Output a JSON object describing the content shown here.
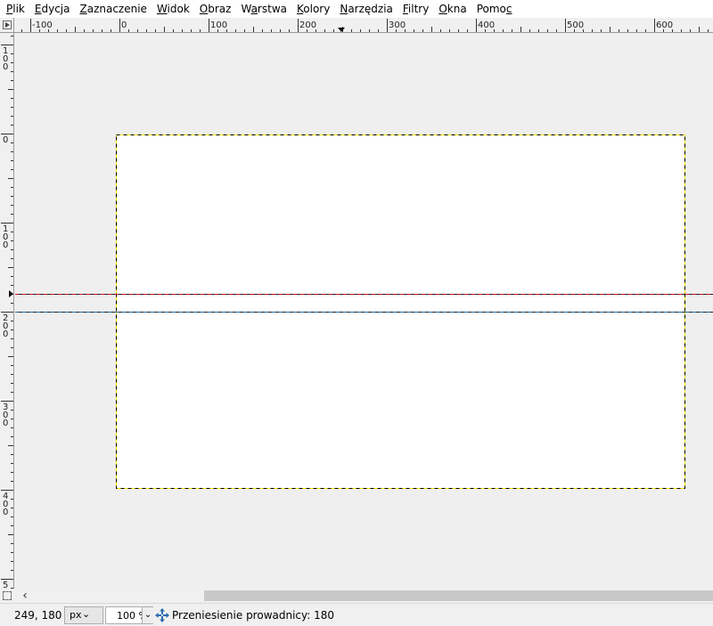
{
  "menubar": {
    "items": [
      {
        "before": "",
        "key": "P",
        "after": "lik"
      },
      {
        "before": "",
        "key": "E",
        "after": "dycja"
      },
      {
        "before": "",
        "key": "Z",
        "after": "aznaczenie"
      },
      {
        "before": "",
        "key": "W",
        "after": "idok"
      },
      {
        "before": "",
        "key": "O",
        "after": "braz"
      },
      {
        "before": "W",
        "key": "a",
        "after": "rstwa"
      },
      {
        "before": "",
        "key": "K",
        "after": "olory"
      },
      {
        "before": "",
        "key": "N",
        "after": "arzędzia"
      },
      {
        "before": "",
        "key": "F",
        "after": "iltry"
      },
      {
        "before": "",
        "key": "O",
        "after": "kna"
      },
      {
        "before": "Pomo",
        "key": "c",
        "after": ""
      }
    ]
  },
  "rulers": {
    "horizontal_labels": [
      "-100",
      "0",
      "100",
      "200",
      "300",
      "400",
      "500",
      "600"
    ],
    "vertical_labels": [
      "100",
      "0",
      "100",
      "200",
      "300",
      "400",
      "5"
    ]
  },
  "canvas": {
    "background": "#efefef",
    "image_background": "#ffffff",
    "selection_colors": [
      "#000000",
      "#f2e600"
    ],
    "guides": [
      {
        "position": 180,
        "color": "#d01010",
        "active": true
      },
      {
        "position": 200,
        "color": "#1a6fb0",
        "active": false
      }
    ]
  },
  "status": {
    "coords": "249, 180",
    "unit": "px",
    "zoom": "100 %",
    "message": "Przeniesienie prowadnicy: 180",
    "icon": "move-icon"
  }
}
